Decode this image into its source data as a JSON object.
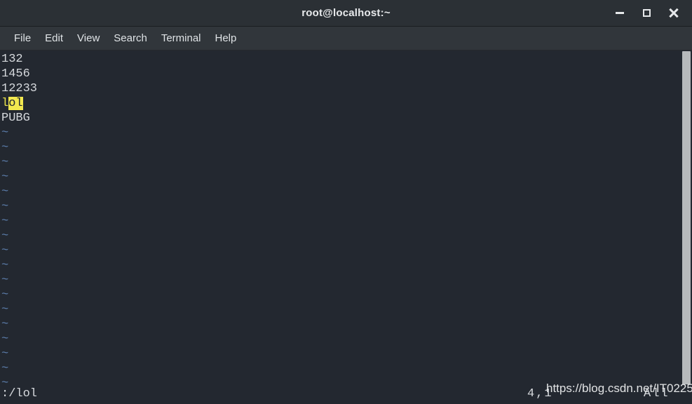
{
  "window": {
    "title": "root@localhost:~",
    "controls": [
      {
        "name": "minimize-button",
        "label": "_"
      },
      {
        "name": "maximize-button",
        "label": "□"
      },
      {
        "name": "close-button",
        "label": "×"
      }
    ]
  },
  "menubar": {
    "items": [
      {
        "label": "File"
      },
      {
        "label": "Edit"
      },
      {
        "label": "View"
      },
      {
        "label": "Search"
      },
      {
        "label": "Terminal"
      },
      {
        "label": "Help"
      }
    ]
  },
  "terminal": {
    "buffer_lines": [
      {
        "text": "132",
        "type": "content"
      },
      {
        "text": "1456",
        "type": "content"
      },
      {
        "text": "12233",
        "type": "content"
      },
      {
        "text": "lol",
        "type": "content-highlighted"
      },
      {
        "text": "PUBG",
        "type": "content"
      },
      {
        "text": "~",
        "type": "filler"
      },
      {
        "text": "~",
        "type": "filler"
      },
      {
        "text": "~",
        "type": "filler"
      },
      {
        "text": "~",
        "type": "filler"
      },
      {
        "text": "~",
        "type": "filler"
      },
      {
        "text": "~",
        "type": "filler"
      },
      {
        "text": "~",
        "type": "filler"
      },
      {
        "text": "~",
        "type": "filler"
      },
      {
        "text": "~",
        "type": "filler"
      },
      {
        "text": "~",
        "type": "filler"
      },
      {
        "text": "~",
        "type": "filler"
      },
      {
        "text": "~",
        "type": "filler"
      },
      {
        "text": "~",
        "type": "filler"
      },
      {
        "text": "~",
        "type": "filler"
      },
      {
        "text": "~",
        "type": "filler"
      },
      {
        "text": "~",
        "type": "filler"
      },
      {
        "text": "~",
        "type": "filler"
      },
      {
        "text": "~",
        "type": "filler"
      },
      {
        "text": "~",
        "type": "filler"
      }
    ],
    "highlighted_line": {
      "match_prefix": "l",
      "cursor_text": "ol"
    }
  },
  "statusline": {
    "command": ":/lol",
    "position": "4,1",
    "scope": "All"
  },
  "watermark": {
    "text": "https://blog.csdn.net/IT0225"
  },
  "colors": {
    "titlebar_bg": "#2b3035",
    "menubar_bg": "#31363b",
    "terminal_bg": "#232830",
    "terminal_fg": "#d6d9dd",
    "tilde_blue": "#5d7fae",
    "search_yellow": "#e8e14a",
    "cursor_yellow": "#f2e84f",
    "scrollbar_thumb": "#b6b9bb"
  }
}
